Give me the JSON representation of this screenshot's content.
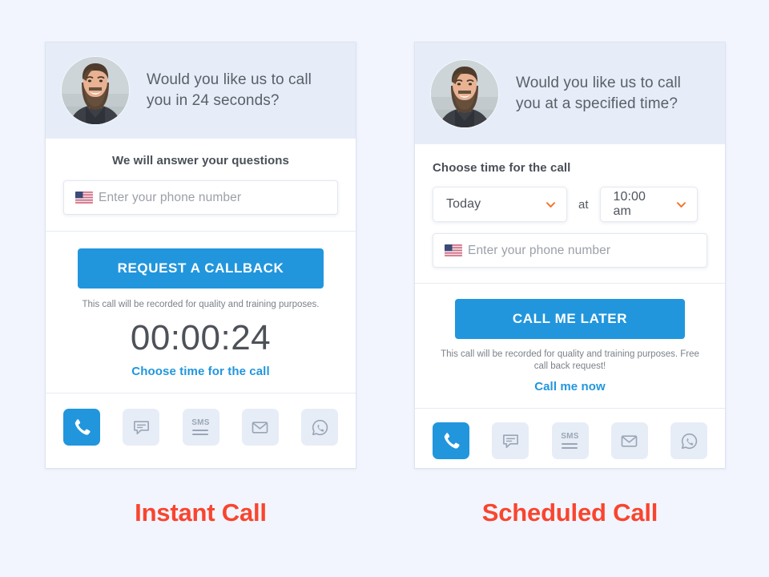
{
  "page": {
    "background_color": "#f2f5fd",
    "accent_blue": "#2196dd",
    "accent_orange": "#f3752b",
    "caption_color": "#f9452f"
  },
  "instant_card": {
    "header": {
      "avatar_alt": "agent-photo",
      "question": "Would you like us to call you in 24 seconds?"
    },
    "subtitle": "We will answer your questions",
    "phone_field": {
      "placeholder": "Enter your phone number",
      "value": "",
      "country_flag": "us-flag-icon"
    },
    "cta_label": "REQUEST A CALLBACK",
    "disclaimer": "This call will be recorded for quality and training purposes.",
    "timer": "00:00:24",
    "link_label": "Choose time for the call",
    "channels": [
      {
        "name": "phone",
        "icon": "phone-icon",
        "active": true
      },
      {
        "name": "chat",
        "icon": "chat-bubble-icon",
        "active": false
      },
      {
        "name": "sms",
        "icon": "sms-icon",
        "active": false,
        "label": "SMS"
      },
      {
        "name": "email",
        "icon": "envelope-icon",
        "active": false
      },
      {
        "name": "whatsapp",
        "icon": "whatsapp-icon",
        "active": false
      }
    ],
    "caption": "Instant Call"
  },
  "scheduled_card": {
    "header": {
      "avatar_alt": "agent-photo",
      "question": "Would you like us to call you at a specified time?"
    },
    "subtitle": "Choose time for the call",
    "day_select": {
      "value": "Today",
      "options": [
        "Today"
      ]
    },
    "at_label": "at",
    "time_select": {
      "value": "10:00 am",
      "options": [
        "10:00 am"
      ]
    },
    "phone_field": {
      "placeholder": "Enter your phone number",
      "value": "",
      "country_flag": "us-flag-icon"
    },
    "cta_label": "CALL ME LATER",
    "disclaimer": "This call will be recorded for quality and training purposes. Free call back request!",
    "link_label": "Call me now",
    "channels": [
      {
        "name": "phone",
        "icon": "phone-icon",
        "active": true
      },
      {
        "name": "chat",
        "icon": "chat-bubble-icon",
        "active": false
      },
      {
        "name": "sms",
        "icon": "sms-icon",
        "active": false,
        "label": "SMS"
      },
      {
        "name": "email",
        "icon": "envelope-icon",
        "active": false
      },
      {
        "name": "whatsapp",
        "icon": "whatsapp-icon",
        "active": false
      }
    ],
    "caption": "Scheduled Call"
  }
}
